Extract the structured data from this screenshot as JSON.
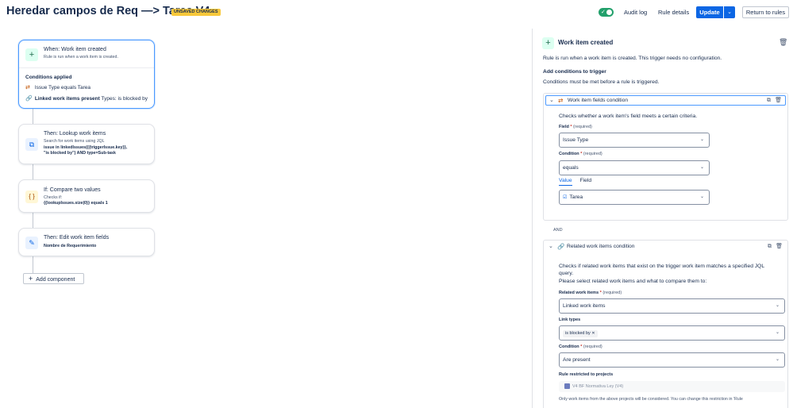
{
  "header": {
    "title": "Heredar campos de Req —> Tarea V4",
    "badge": "UNSAVED CHANGES",
    "toggle_state": "on",
    "audit_log": "Audit log",
    "rule_details": "Rule details",
    "update": "Update",
    "update_caret": "⌄",
    "return_to_rules": "Return to rules",
    "accent_color": "#0c66e4"
  },
  "canvas": {
    "trigger": {
      "icon": "plus-icon",
      "title": "When: Work item created",
      "subtitle": "Rule is run when a work item is created.",
      "conditions_heading": "Conditions applied",
      "conditions": [
        {
          "icon": "swap-icon",
          "text": "Issue Type equals Tarea"
        },
        {
          "icon": "link-icon",
          "bold": "Linked work items present",
          "text": " Types: is blocked by"
        }
      ]
    },
    "action1": {
      "icon": "lookup-icon",
      "title": "Then: Lookup work items",
      "line1": "Search for work items using JQL",
      "line2": "issue in linkedIssues({{triggerIssue.key}},",
      "line3": "\"is blocked by\") AND type=Sub-task"
    },
    "if_block": {
      "icon": "braces-icon",
      "title": "If: Compare two values",
      "line1": "Checks if:",
      "line2": "{{lookupIssues.size|0}} equals 1"
    },
    "action2": {
      "icon": "edit-icon",
      "title": "Then: Edit work item fields",
      "line1": "Nombre de Requerimiento"
    },
    "add_component": "Add component"
  },
  "panel": {
    "title": "Work item created",
    "description": "Rule is run when a work item is created. This trigger needs no configuration.",
    "add_conditions": "Add conditions to trigger",
    "conditions_note": "Conditions must be met before a rule is triggered.",
    "condition1": {
      "label": "Work item fields condition",
      "description": "Checks whether a work item's field meets a certain criteria.",
      "field_label": "Field",
      "required": "(required)",
      "field_value": "Issue Type",
      "condition_label": "Condition",
      "condition_value": "equals",
      "tabs": [
        "Value",
        "Field"
      ],
      "value": "Tarea"
    },
    "and_label": "AND",
    "condition2": {
      "label": "Related work items condition",
      "description_1": "Checks if related work items that exist on the trigger work item matches a specified JQL",
      "description_2": "query.",
      "description_3": "Please select related work items and what to compare them to:",
      "related_label": "Related work items",
      "required": "(required)",
      "related_value": "Linked work items",
      "link_types_label": "Link types",
      "link_type_tag": "is blocked by",
      "condition_label": "Condition",
      "condition_value": "Are present",
      "restricted_label": "Rule restricted to projects",
      "project": "V4 BF Normativa Ley (V4)",
      "note": "Only work items from the above projects will be considered. You can change this restriction in 'Rule"
    }
  }
}
